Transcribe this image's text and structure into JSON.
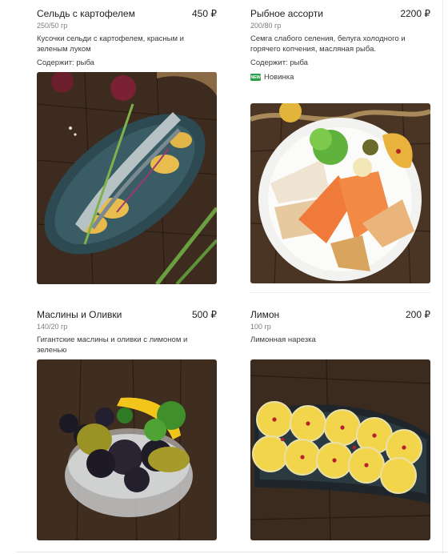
{
  "dishes": [
    {
      "name": "Сельдь с картофелем",
      "price": "450 ₽",
      "weight": "250/50 гр",
      "description": "Кусочки сельди с картофелем, красным и зеленым луком",
      "contains": "Содержит: рыба",
      "image_alt": "herring-with-potatoes-photo"
    },
    {
      "name": "Рыбное ассорти",
      "price": "2200 ₽",
      "weight": "200/80 гр",
      "description": "Семга слабого селения, белуга холодного и горячего копчения, масляная рыба.",
      "contains": "Содержит: рыба",
      "badge_icon_text": "NEW",
      "badge_label": "Новинка",
      "image_alt": "fish-platter-photo"
    },
    {
      "name": "Маслины и Оливки",
      "price": "500 ₽",
      "weight": "140/20 гр",
      "description": "Гигантские маслины и оливки с лимоном и зеленью",
      "image_alt": "olives-bowl-photo"
    },
    {
      "name": "Лимон",
      "price": "200 ₽",
      "weight": "100 гр",
      "description": "Лимонная нарезка",
      "image_alt": "lemon-slices-photo"
    }
  ],
  "colors": {
    "badge_green": "#2e9f48",
    "wood_dark": "#3b2a1e",
    "wood_mid": "#5a4130"
  }
}
